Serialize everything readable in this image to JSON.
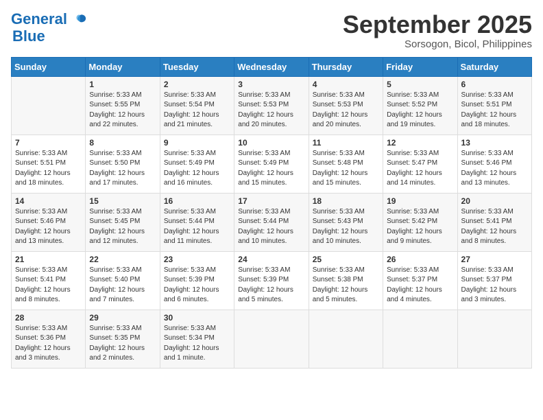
{
  "header": {
    "logo_line1": "General",
    "logo_line2": "Blue",
    "month": "September 2025",
    "location": "Sorsogon, Bicol, Philippines"
  },
  "days_of_week": [
    "Sunday",
    "Monday",
    "Tuesday",
    "Wednesday",
    "Thursday",
    "Friday",
    "Saturday"
  ],
  "weeks": [
    [
      {
        "day": "",
        "info": ""
      },
      {
        "day": "1",
        "info": "Sunrise: 5:33 AM\nSunset: 5:55 PM\nDaylight: 12 hours\nand 22 minutes."
      },
      {
        "day": "2",
        "info": "Sunrise: 5:33 AM\nSunset: 5:54 PM\nDaylight: 12 hours\nand 21 minutes."
      },
      {
        "day": "3",
        "info": "Sunrise: 5:33 AM\nSunset: 5:53 PM\nDaylight: 12 hours\nand 20 minutes."
      },
      {
        "day": "4",
        "info": "Sunrise: 5:33 AM\nSunset: 5:53 PM\nDaylight: 12 hours\nand 20 minutes."
      },
      {
        "day": "5",
        "info": "Sunrise: 5:33 AM\nSunset: 5:52 PM\nDaylight: 12 hours\nand 19 minutes."
      },
      {
        "day": "6",
        "info": "Sunrise: 5:33 AM\nSunset: 5:51 PM\nDaylight: 12 hours\nand 18 minutes."
      }
    ],
    [
      {
        "day": "7",
        "info": "Sunrise: 5:33 AM\nSunset: 5:51 PM\nDaylight: 12 hours\nand 18 minutes."
      },
      {
        "day": "8",
        "info": "Sunrise: 5:33 AM\nSunset: 5:50 PM\nDaylight: 12 hours\nand 17 minutes."
      },
      {
        "day": "9",
        "info": "Sunrise: 5:33 AM\nSunset: 5:49 PM\nDaylight: 12 hours\nand 16 minutes."
      },
      {
        "day": "10",
        "info": "Sunrise: 5:33 AM\nSunset: 5:49 PM\nDaylight: 12 hours\nand 15 minutes."
      },
      {
        "day": "11",
        "info": "Sunrise: 5:33 AM\nSunset: 5:48 PM\nDaylight: 12 hours\nand 15 minutes."
      },
      {
        "day": "12",
        "info": "Sunrise: 5:33 AM\nSunset: 5:47 PM\nDaylight: 12 hours\nand 14 minutes."
      },
      {
        "day": "13",
        "info": "Sunrise: 5:33 AM\nSunset: 5:46 PM\nDaylight: 12 hours\nand 13 minutes."
      }
    ],
    [
      {
        "day": "14",
        "info": "Sunrise: 5:33 AM\nSunset: 5:46 PM\nDaylight: 12 hours\nand 13 minutes."
      },
      {
        "day": "15",
        "info": "Sunrise: 5:33 AM\nSunset: 5:45 PM\nDaylight: 12 hours\nand 12 minutes."
      },
      {
        "day": "16",
        "info": "Sunrise: 5:33 AM\nSunset: 5:44 PM\nDaylight: 12 hours\nand 11 minutes."
      },
      {
        "day": "17",
        "info": "Sunrise: 5:33 AM\nSunset: 5:44 PM\nDaylight: 12 hours\nand 10 minutes."
      },
      {
        "day": "18",
        "info": "Sunrise: 5:33 AM\nSunset: 5:43 PM\nDaylight: 12 hours\nand 10 minutes."
      },
      {
        "day": "19",
        "info": "Sunrise: 5:33 AM\nSunset: 5:42 PM\nDaylight: 12 hours\nand 9 minutes."
      },
      {
        "day": "20",
        "info": "Sunrise: 5:33 AM\nSunset: 5:41 PM\nDaylight: 12 hours\nand 8 minutes."
      }
    ],
    [
      {
        "day": "21",
        "info": "Sunrise: 5:33 AM\nSunset: 5:41 PM\nDaylight: 12 hours\nand 8 minutes."
      },
      {
        "day": "22",
        "info": "Sunrise: 5:33 AM\nSunset: 5:40 PM\nDaylight: 12 hours\nand 7 minutes."
      },
      {
        "day": "23",
        "info": "Sunrise: 5:33 AM\nSunset: 5:39 PM\nDaylight: 12 hours\nand 6 minutes."
      },
      {
        "day": "24",
        "info": "Sunrise: 5:33 AM\nSunset: 5:39 PM\nDaylight: 12 hours\nand 5 minutes."
      },
      {
        "day": "25",
        "info": "Sunrise: 5:33 AM\nSunset: 5:38 PM\nDaylight: 12 hours\nand 5 minutes."
      },
      {
        "day": "26",
        "info": "Sunrise: 5:33 AM\nSunset: 5:37 PM\nDaylight: 12 hours\nand 4 minutes."
      },
      {
        "day": "27",
        "info": "Sunrise: 5:33 AM\nSunset: 5:37 PM\nDaylight: 12 hours\nand 3 minutes."
      }
    ],
    [
      {
        "day": "28",
        "info": "Sunrise: 5:33 AM\nSunset: 5:36 PM\nDaylight: 12 hours\nand 3 minutes."
      },
      {
        "day": "29",
        "info": "Sunrise: 5:33 AM\nSunset: 5:35 PM\nDaylight: 12 hours\nand 2 minutes."
      },
      {
        "day": "30",
        "info": "Sunrise: 5:33 AM\nSunset: 5:34 PM\nDaylight: 12 hours\nand 1 minute."
      },
      {
        "day": "",
        "info": ""
      },
      {
        "day": "",
        "info": ""
      },
      {
        "day": "",
        "info": ""
      },
      {
        "day": "",
        "info": ""
      }
    ]
  ]
}
